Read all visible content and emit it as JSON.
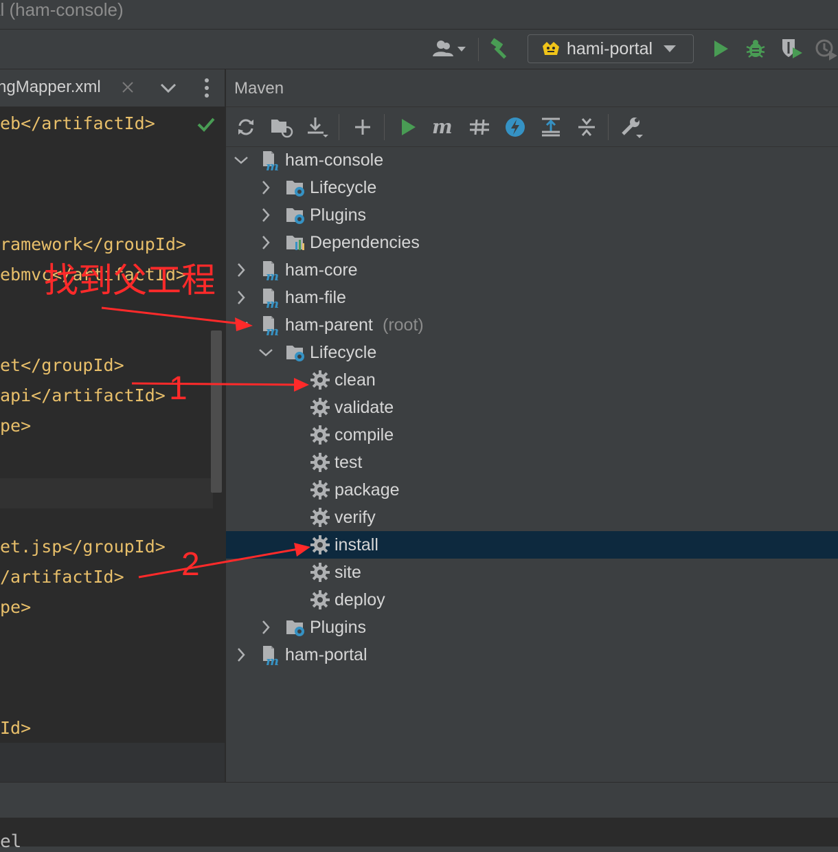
{
  "window": {
    "title": "al (ham-console)"
  },
  "toolbar": {
    "run_config": "hami-portal"
  },
  "editor": {
    "tab_filename": "ngMapper.xml",
    "lines": [
      "eb</artifactId>",
      "ramework</groupId>",
      "ebmvc</artifactId>",
      "et</groupId>",
      "api</artifactId>",
      "pe>",
      "et.jsp</groupId>",
      "/artifactId>",
      "pe>",
      "Id>"
    ]
  },
  "maven": {
    "title": "Maven",
    "tree": [
      {
        "label": "ham-console",
        "kind": "module",
        "expanded": true
      },
      {
        "label": "Lifecycle",
        "kind": "lifecycle",
        "expanded": false
      },
      {
        "label": "Plugins",
        "kind": "plugins",
        "expanded": false
      },
      {
        "label": "Dependencies",
        "kind": "dependencies",
        "expanded": false
      },
      {
        "label": "ham-core",
        "kind": "module",
        "expanded": false
      },
      {
        "label": "ham-file",
        "kind": "module",
        "expanded": false
      },
      {
        "label": "ham-parent",
        "suffix": "(root)",
        "kind": "module",
        "expanded": true
      },
      {
        "label": "Lifecycle",
        "kind": "lifecycle",
        "expanded": true
      },
      {
        "label": "clean",
        "kind": "goal"
      },
      {
        "label": "validate",
        "kind": "goal"
      },
      {
        "label": "compile",
        "kind": "goal"
      },
      {
        "label": "test",
        "kind": "goal"
      },
      {
        "label": "package",
        "kind": "goal"
      },
      {
        "label": "verify",
        "kind": "goal"
      },
      {
        "label": "install",
        "kind": "goal",
        "selected": true
      },
      {
        "label": "site",
        "kind": "goal"
      },
      {
        "label": "deploy",
        "kind": "goal"
      },
      {
        "label": "Plugins",
        "kind": "plugins",
        "expanded": false
      },
      {
        "label": "ham-portal",
        "kind": "module",
        "expanded": false
      }
    ]
  },
  "annotations": {
    "find_parent": "找到父工程",
    "step1": "1",
    "step2": "2",
    "color": "#ff2a2a"
  },
  "bottom": {
    "fragment": "el"
  },
  "colors": {
    "background": "#3c3f41",
    "editor_bg": "#2b2b2b",
    "selection": "#0d293e",
    "xml_tag": "#e8bf6a",
    "run_green": "#499c54"
  }
}
